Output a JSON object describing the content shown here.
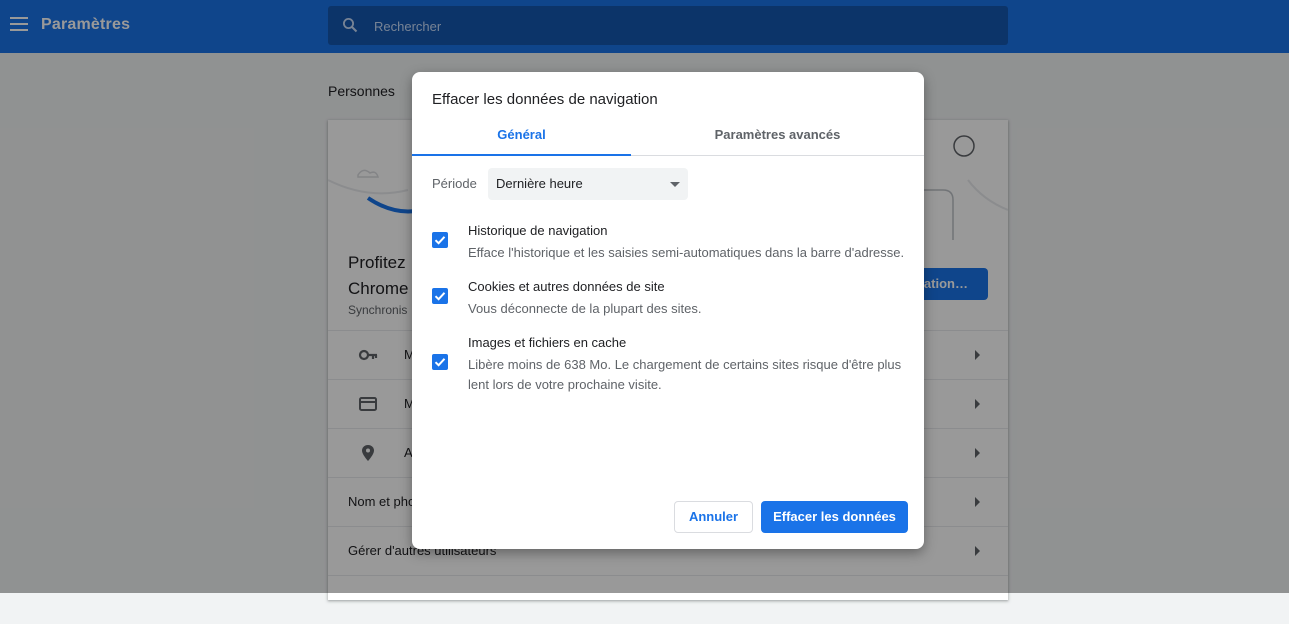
{
  "header": {
    "title": "Paramètres",
    "search_placeholder": "Rechercher"
  },
  "page": {
    "section_title": "Personnes",
    "promo_title_line1": "Profitez",
    "promo_title_line2": "Chrome",
    "promo_subtitle": "Synchronis",
    "sync_button_label": "isation…",
    "rows": [
      {
        "label": "M",
        "icon": "key-icon"
      },
      {
        "label": "M",
        "icon": "credit-card-icon"
      },
      {
        "label": "A",
        "icon": "location-pin-icon"
      },
      {
        "label": "Nom et pho"
      },
      {
        "label": "Gérer d'autres utilisateurs"
      }
    ]
  },
  "dialog": {
    "title": "Effacer les données de navigation",
    "tabs": [
      {
        "label": "Général",
        "active": true
      },
      {
        "label": "Paramètres avancés",
        "active": false
      }
    ],
    "period_label": "Période",
    "period_value": "Dernière heure",
    "options": [
      {
        "title": "Historique de navigation",
        "description": "Efface l'historique et les saisies semi-automatiques dans la barre d'adresse.",
        "checked": true
      },
      {
        "title": "Cookies et autres données de site",
        "description": "Vous déconnecte de la plupart des sites.",
        "checked": true
      },
      {
        "title": "Images et fichiers en cache",
        "description": "Libère moins de 638 Mo. Le chargement de certains sites risque d'être plus lent lors de votre prochaine visite.",
        "checked": true
      }
    ],
    "cancel_label": "Annuler",
    "confirm_label": "Effacer les données"
  },
  "colors": {
    "accent": "#1a73e8",
    "header_bg": "#1a73e8",
    "overlay": "rgba(0,0,0,0.40)"
  }
}
